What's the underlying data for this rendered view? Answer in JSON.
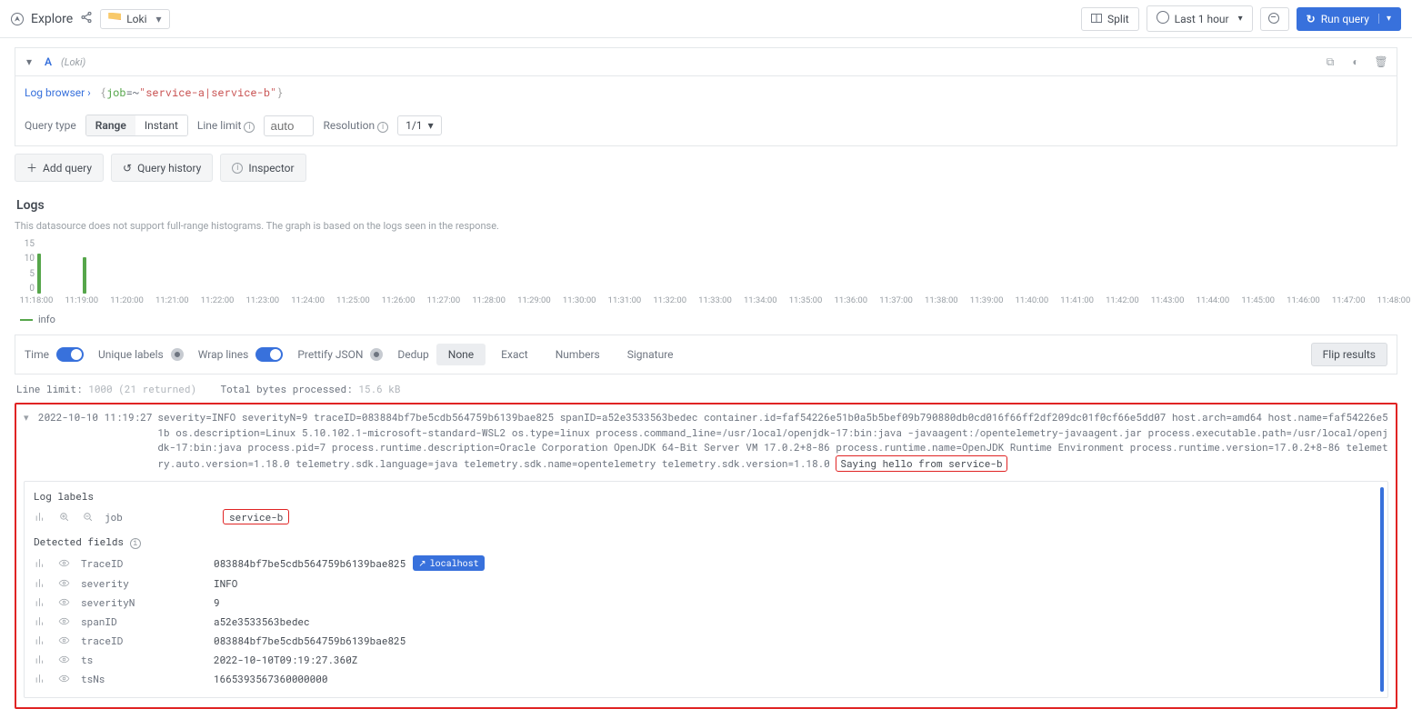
{
  "topbar": {
    "title": "Explore",
    "datasource": "Loki",
    "split": "Split",
    "timerange": "Last 1 hour",
    "run": "Run query"
  },
  "query_panel": {
    "id": "A",
    "ds_label": "(Loki)",
    "log_browser": "Log browser  ›",
    "expr_key": "job",
    "expr_op": "=~",
    "expr_val": "\"service-a|service-b\"",
    "querytype_label": "Query type",
    "range": "Range",
    "instant": "Instant",
    "linelimit_label": "Line limit",
    "linelimit_placeholder": "auto",
    "resolution_label": "Resolution",
    "resolution_value": "1/1"
  },
  "actions": {
    "add_query": "Add query",
    "history": "Query history",
    "inspector": "Inspector"
  },
  "logs": {
    "title": "Logs",
    "hint": "This datasource does not support full-range histograms. The graph is based on the logs seen in the response.",
    "legend": "info"
  },
  "chart_data": {
    "type": "bar",
    "categories": [
      "11:18:00",
      "11:19:00",
      "11:20:00",
      "11:21:00",
      "11:22:00",
      "11:23:00",
      "11:24:00",
      "11:25:00",
      "11:26:00",
      "11:27:00",
      "11:28:00",
      "11:29:00",
      "11:30:00",
      "11:31:00",
      "11:32:00",
      "11:33:00",
      "11:34:00",
      "11:35:00",
      "11:36:00",
      "11:37:00",
      "11:38:00",
      "11:39:00",
      "11:40:00",
      "11:41:00",
      "11:42:00",
      "11:43:00",
      "11:44:00",
      "11:45:00",
      "11:46:00",
      "11:47:00",
      "11:48:00"
    ],
    "values": [
      11,
      10,
      0,
      0,
      0,
      0,
      0,
      0,
      0,
      0,
      0,
      0,
      0,
      0,
      0,
      0,
      0,
      0,
      0,
      0,
      0,
      0,
      0,
      0,
      0,
      0,
      0,
      0,
      0,
      0,
      0
    ],
    "yticks": [
      15,
      10,
      5,
      0
    ],
    "ylim": [
      0,
      15
    ],
    "series_name": "info",
    "color": "#56a64b"
  },
  "toolbar": {
    "time": "Time",
    "unique": "Unique labels",
    "wrap": "Wrap lines",
    "prettify": "Prettify JSON",
    "dedup": "Dedup",
    "dedup_options": [
      "None",
      "Exact",
      "Numbers",
      "Signature"
    ],
    "dedup_active": "None",
    "flip": "Flip results"
  },
  "meta": {
    "line_limit_label": "Line limit:",
    "line_limit_value": "1000",
    "line_limit_returned": "(21 returned)",
    "bytes_label": "Total bytes processed:",
    "bytes_value": "15.6 kB"
  },
  "entry": {
    "ts": "2022-10-10 11:19:27",
    "body_prefix": "severity=INFO severityN=9 traceID=083884bf7be5cdb564759b6139bae825 spanID=a52e3533563bedec container.id=faf54226e51b0a5b5bef09b790880db0cd016f66ff2df209dc01f0cf66e5dd07 host.arch=amd64 host.name=faf54226e51b os.description=Linux 5.10.102.1-microsoft-standard-WSL2 os.type=linux process.command_line=/usr/local/openjdk-17:bin:java -javaagent:/opentelemetry-javaagent.jar process.executable.path=/usr/local/openjdk-17:bin:java process.pid=7 process.runtime.description=Oracle Corporation OpenJDK 64-Bit Server VM 17.0.2+8-86 process.runtime.name=OpenJDK Runtime Environment process.runtime.version=17.0.2+8-86 telemetry.auto.version=1.18.0 telemetry.sdk.language=java telemetry.sdk.name=opentelemetry telemetry.sdk.version=1.18.0",
    "body_highlight": "Saying hello from service-b"
  },
  "labels": {
    "section": "Log labels",
    "job_key": "job",
    "job_val": "service-b",
    "detected": "Detected fields",
    "fields": [
      {
        "k": "TraceID",
        "v": "083884bf7be5cdb564759b6139bae825",
        "link": "localhost"
      },
      {
        "k": "severity",
        "v": "INFO"
      },
      {
        "k": "severityN",
        "v": "9"
      },
      {
        "k": "spanID",
        "v": "a52e3533563bedec"
      },
      {
        "k": "traceID",
        "v": "083884bf7be5cdb564759b6139bae825"
      },
      {
        "k": "ts",
        "v": "2022-10-10T09:19:27.360Z"
      },
      {
        "k": "tsNs",
        "v": "1665393567360000000"
      }
    ]
  }
}
